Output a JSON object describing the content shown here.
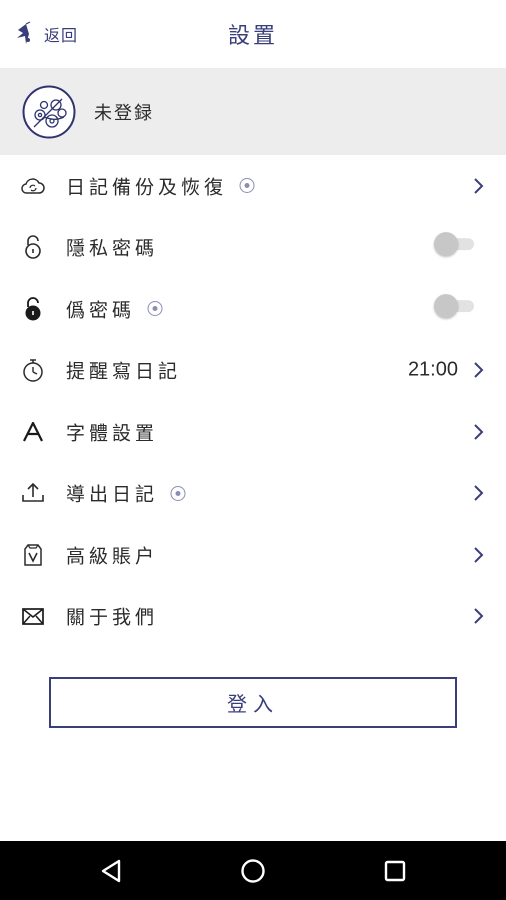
{
  "header": {
    "back_label": "返回",
    "title": "設置"
  },
  "profile": {
    "name": "未登録"
  },
  "menu": {
    "items": [
      {
        "id": "backup",
        "label": "日記備份及恢復",
        "badge": true,
        "control": "chevron",
        "icon": "cloud-sync-icon"
      },
      {
        "id": "privacy",
        "label": "隱私密碼",
        "badge": false,
        "control": "toggle",
        "toggle_on": false,
        "icon": "lock-open-icon"
      },
      {
        "id": "fake-password",
        "label": "僞密碼",
        "badge": true,
        "control": "toggle",
        "toggle_on": false,
        "icon": "lock-filled-icon"
      },
      {
        "id": "reminder",
        "label": "提醒寫日記",
        "badge": false,
        "control": "chevron",
        "value": "21:00",
        "icon": "stopwatch-icon"
      },
      {
        "id": "font",
        "label": "字體設置",
        "badge": false,
        "control": "chevron",
        "icon": "font-icon"
      },
      {
        "id": "export",
        "label": "導出日記",
        "badge": true,
        "control": "chevron",
        "icon": "upload-icon"
      },
      {
        "id": "premium",
        "label": "高級賬户",
        "badge": false,
        "control": "chevron",
        "icon": "vip-icon"
      },
      {
        "id": "about",
        "label": "關于我們",
        "badge": false,
        "control": "chevron",
        "icon": "mail-icon"
      }
    ]
  },
  "login_button": {
    "label": "登入"
  },
  "colors": {
    "accent": "#3a3f7a",
    "profile_bg": "#ededed",
    "chevron": "#3a3f7a",
    "navbar_bg": "#000000"
  }
}
